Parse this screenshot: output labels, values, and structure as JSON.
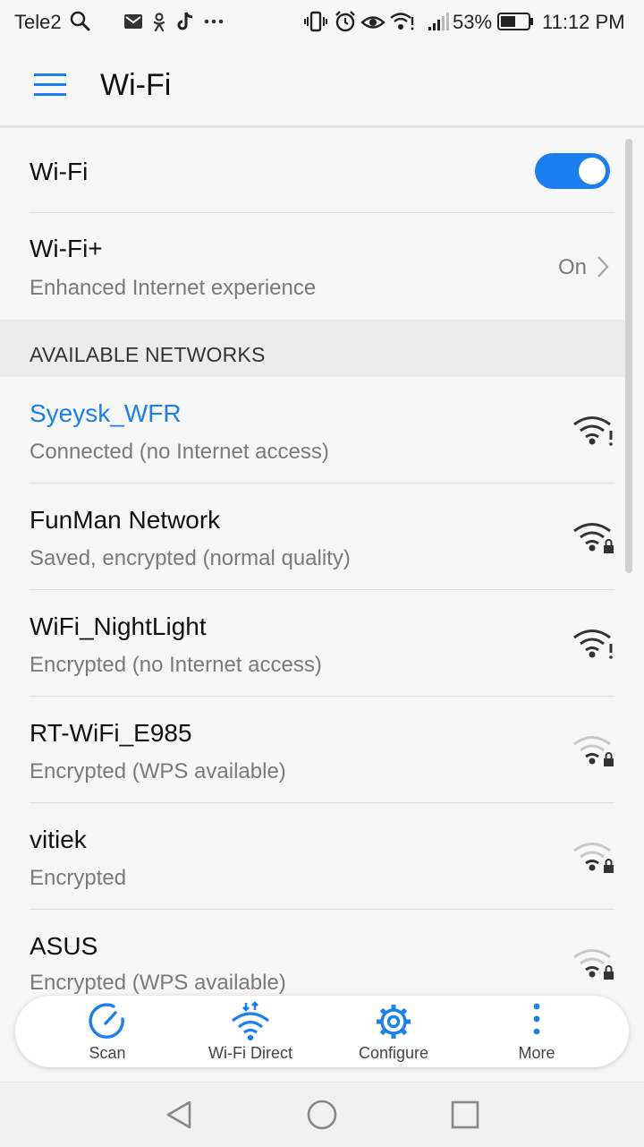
{
  "status_bar": {
    "carrier": "Tele2",
    "battery_percent": "53%",
    "time": "11:12 PM"
  },
  "header": {
    "title": "Wi-Fi"
  },
  "wifi_toggle": {
    "label": "Wi-Fi",
    "enabled": true
  },
  "wifi_plus": {
    "title": "Wi-Fi+",
    "subtitle": "Enhanced Internet experience",
    "value": "On"
  },
  "available_networks": {
    "header": "AVAILABLE NETWORKS",
    "items": [
      {
        "name": "Syeysk_WFR",
        "status": "Connected (no Internet access)",
        "signal_icon": "wifi-alert-icon"
      },
      {
        "name": "FunMan Network",
        "status": "Saved, encrypted (normal quality)",
        "signal_icon": "wifi-lock-icon"
      },
      {
        "name": "WiFi_NightLight",
        "status": "Encrypted (no Internet access)",
        "signal_icon": "wifi-alert-icon"
      },
      {
        "name": "RT-WiFi_E985",
        "status": "Encrypted (WPS available)",
        "signal_icon": "wifi-lock-icon"
      },
      {
        "name": "vitiek",
        "status": "Encrypted",
        "signal_icon": "wifi-lock-icon"
      },
      {
        "name": "ASUS",
        "status": "Encrypted (WPS available)",
        "signal_icon": "wifi-lock-icon"
      }
    ]
  },
  "bottom_actions": {
    "scan": "Scan",
    "wifi_direct": "Wi-Fi Direct",
    "configure": "Configure",
    "more": "More"
  },
  "colors": {
    "accent": "#1a7ff0",
    "connected_name": "#1a7ff0",
    "secondary_text": "#7a7a7a"
  }
}
